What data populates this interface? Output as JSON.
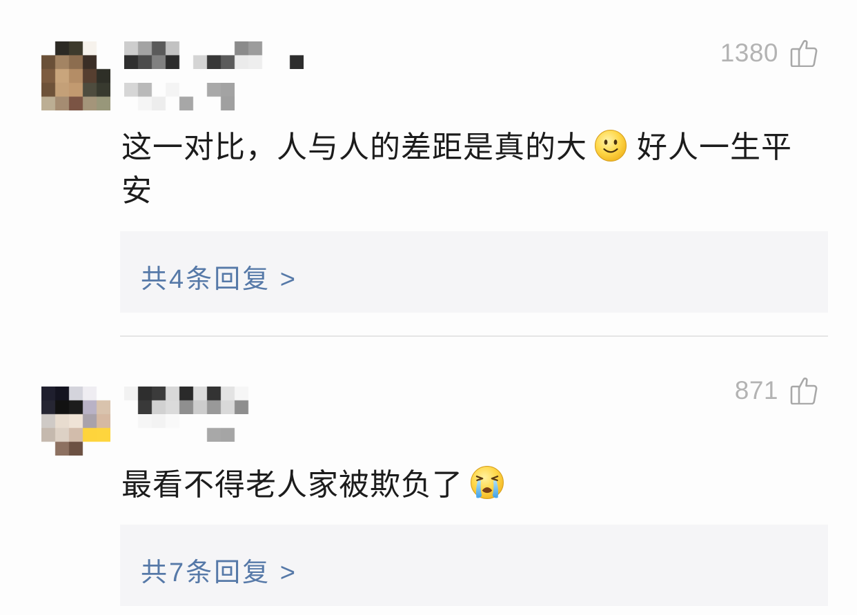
{
  "colors": {
    "page_background": "#fdfdfd",
    "comment_text": "#1c1c1c",
    "like_count": "#b3b3b3",
    "like_icon": "#a8a8a8",
    "reply_link": "#5679a8",
    "reply_box_background": "#f5f5f7",
    "divider": "#e5e5e5"
  },
  "icons": {
    "like": "thumbs-up-icon"
  },
  "comments": [
    {
      "like_count": "1380",
      "text_before_emoji": "这一对比，人与人的差距是真的大",
      "emoji": "smile-emoji",
      "text_after_emoji": "好人一生平安",
      "reply_link": "共4条回复 >"
    },
    {
      "like_count": "871",
      "text_before_emoji": "最看不得老人家被欺负了",
      "emoji": "crying-emoji",
      "reply_link": "共7条回复 >"
    }
  ]
}
